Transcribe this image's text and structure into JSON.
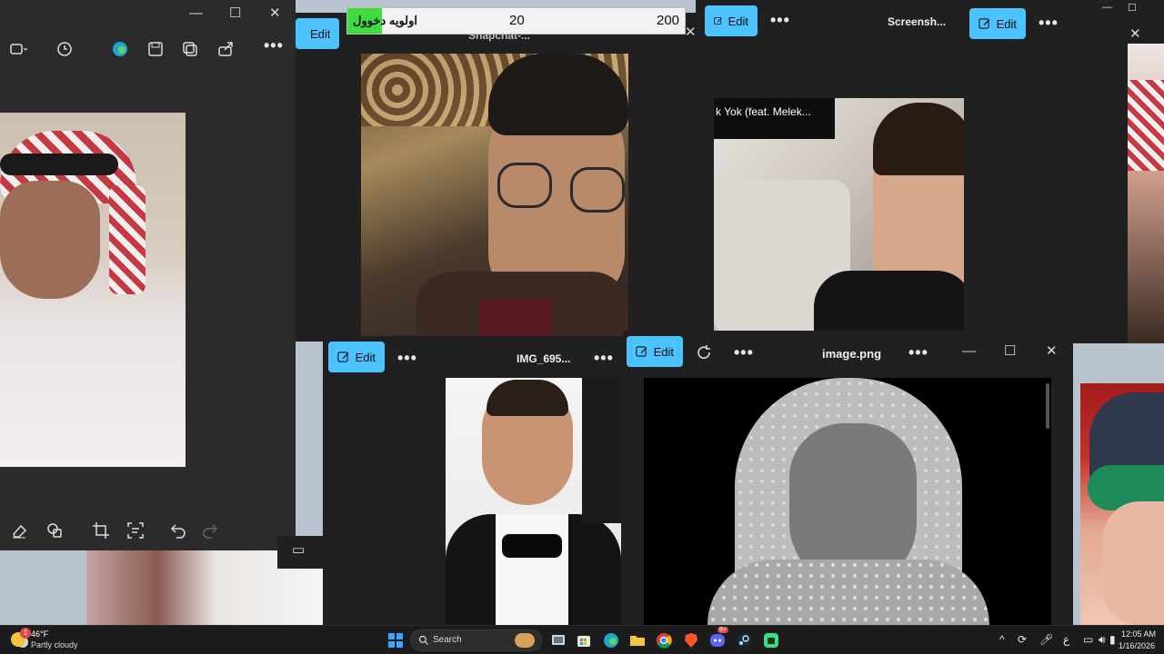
{
  "colors": {
    "accent": "#4cc2ff",
    "window_bg": "#202020",
    "priority_green": "#3fdc3f"
  },
  "windows": {
    "left": {
      "toolbar_icons": [
        "select-icon",
        "history-icon",
        "edge-icon",
        "save-icon",
        "copy-icon",
        "share-icon",
        "more-icon"
      ],
      "bottom_icons": [
        "eraser-icon",
        "shapes-icon",
        "crop-icon",
        "text-extract-icon",
        "undo-icon",
        "redo-icon"
      ]
    },
    "snapchat": {
      "title": "Snapchat-...",
      "edit_label": "Edit"
    },
    "screenshot": {
      "title": "Screensh...",
      "edit_label": "Edit",
      "caption": "k Yok (feat. Melek..."
    },
    "right_small": {
      "edit_label": "Edit"
    },
    "img695": {
      "title": "IMG_695...",
      "edit_label": "Edit"
    },
    "image_png": {
      "title": "image.png",
      "edit_label": "Edit"
    }
  },
  "priority_bar": {
    "label": "اولويه دخوول",
    "value_a": "20",
    "value_b": "200"
  },
  "taskbar": {
    "weather_temp": "46°F",
    "weather_desc": "Partly cloudy",
    "weather_badge": "1",
    "search_label": "Search",
    "lang": "ع",
    "time": "12:05 AM",
    "date": "1/16/2026",
    "discord_badge": "9+"
  }
}
